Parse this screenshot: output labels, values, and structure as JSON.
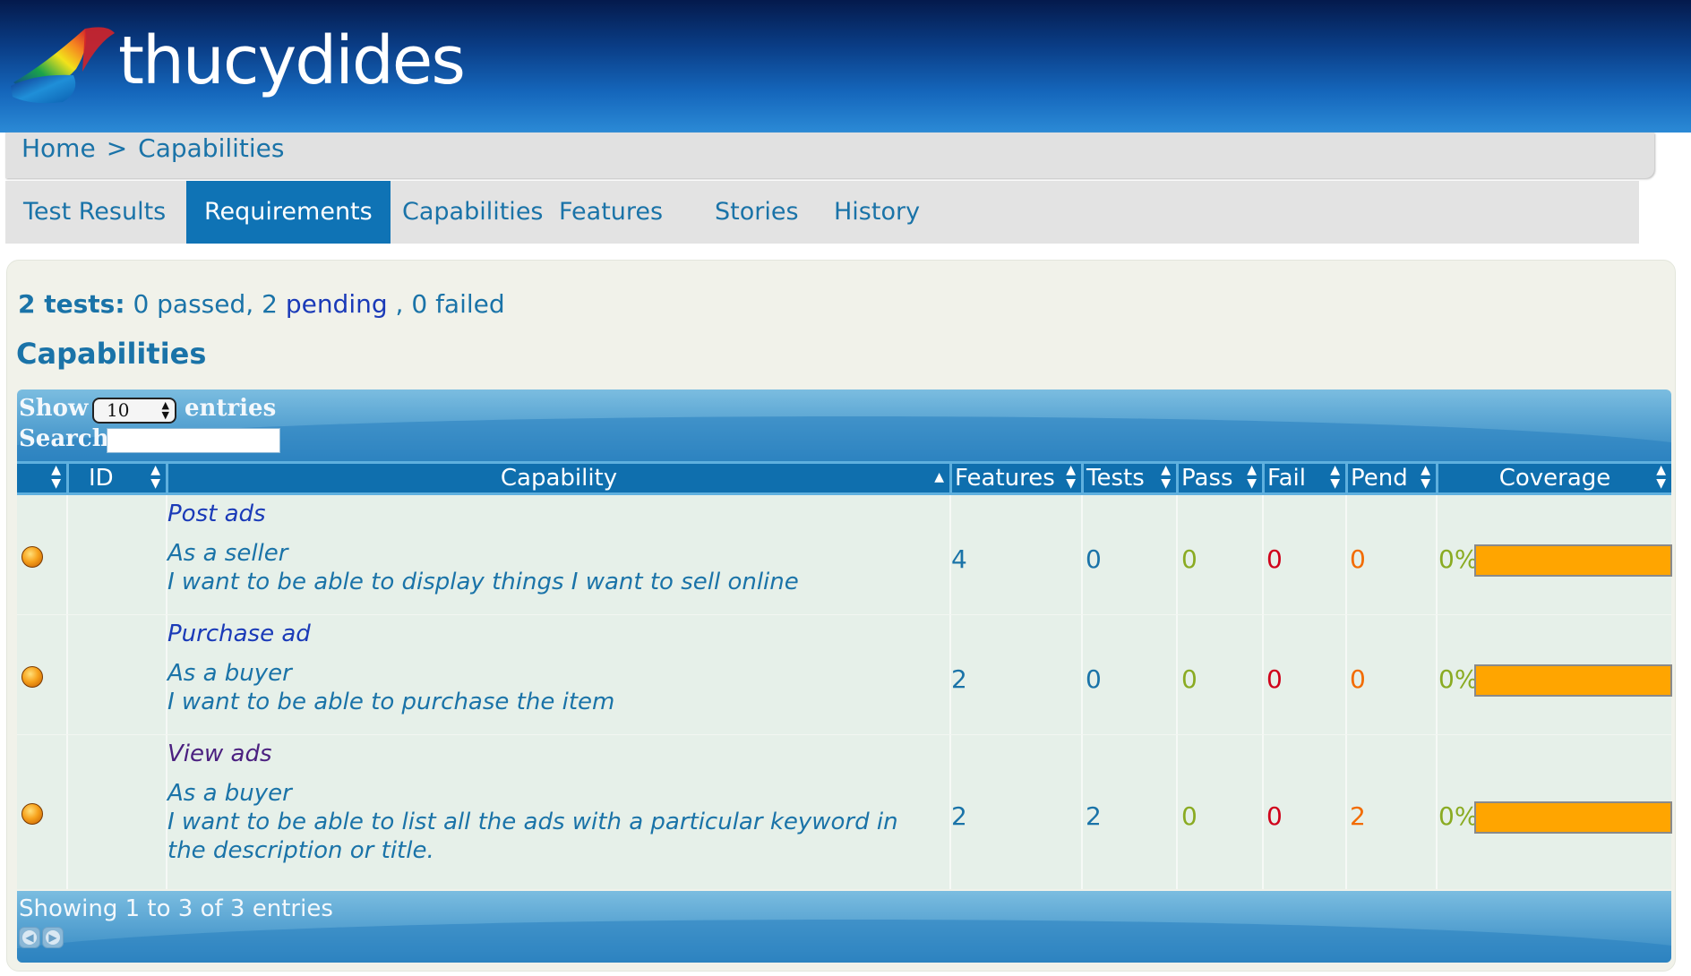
{
  "header": {
    "logo_text": "thucydides"
  },
  "breadcrumb": {
    "home": "Home",
    "separator": ">",
    "current": "Capabilities"
  },
  "tabs": [
    {
      "label": "Test Results",
      "active": false
    },
    {
      "label": "Requirements",
      "active": true
    },
    {
      "label": "Capabilities",
      "active": false
    },
    {
      "label": "Features",
      "active": false
    },
    {
      "label": "Stories",
      "active": false
    },
    {
      "label": "History",
      "active": false
    }
  ],
  "summary": {
    "count_label": "2 tests:",
    "passed": "0 passed,",
    "pending_count": "2",
    "pending_label": "pending",
    "failed": ", 0 failed"
  },
  "section_title": "Capabilities",
  "table": {
    "show_label": "Show",
    "entries_label": "entries",
    "page_length": "10",
    "search_label": "Search:",
    "search_value": "",
    "columns": [
      "",
      "ID",
      "Capability",
      "Features",
      "Tests",
      "Pass",
      "Fail",
      "Pend",
      "Coverage"
    ],
    "rows": [
      {
        "status": "pending",
        "id": "",
        "title": "Post ads",
        "narrative_1": "As a seller",
        "narrative_2": "I want to be able to display things I want to sell online",
        "narrative_3": "",
        "features": "4",
        "tests": "0",
        "pass": "0",
        "fail": "0",
        "pend": "0",
        "coverage": "0%",
        "coverage_fraction": 0
      },
      {
        "status": "pending",
        "id": "",
        "title": "Purchase ad",
        "narrative_1": "As a buyer",
        "narrative_2": "I want to be able to purchase the item",
        "narrative_3": "",
        "features": "2",
        "tests": "0",
        "pass": "0",
        "fail": "0",
        "pend": "0",
        "coverage": "0%",
        "coverage_fraction": 0
      },
      {
        "status": "pending",
        "id": "",
        "title": "View ads",
        "narrative_1": "As a buyer",
        "narrative_2": "I want to be able to list all the ads with a particular keyword in",
        "narrative_3": "the description or title.",
        "features": "2",
        "tests": "2",
        "pass": "0",
        "fail": "0",
        "pend": "2",
        "coverage": "0%",
        "coverage_fraction": 0
      }
    ],
    "info": "Showing 1 to 3 of 3 entries"
  },
  "colors": {
    "header_dark": "#041a4c",
    "tab_active": "#0f73b5",
    "link_blue": "#1a73a8",
    "pass_green": "#8aab22",
    "fail_red": "#d0021b",
    "pending_orange": "#f26b00",
    "coverage_bar": "#ffa500"
  }
}
